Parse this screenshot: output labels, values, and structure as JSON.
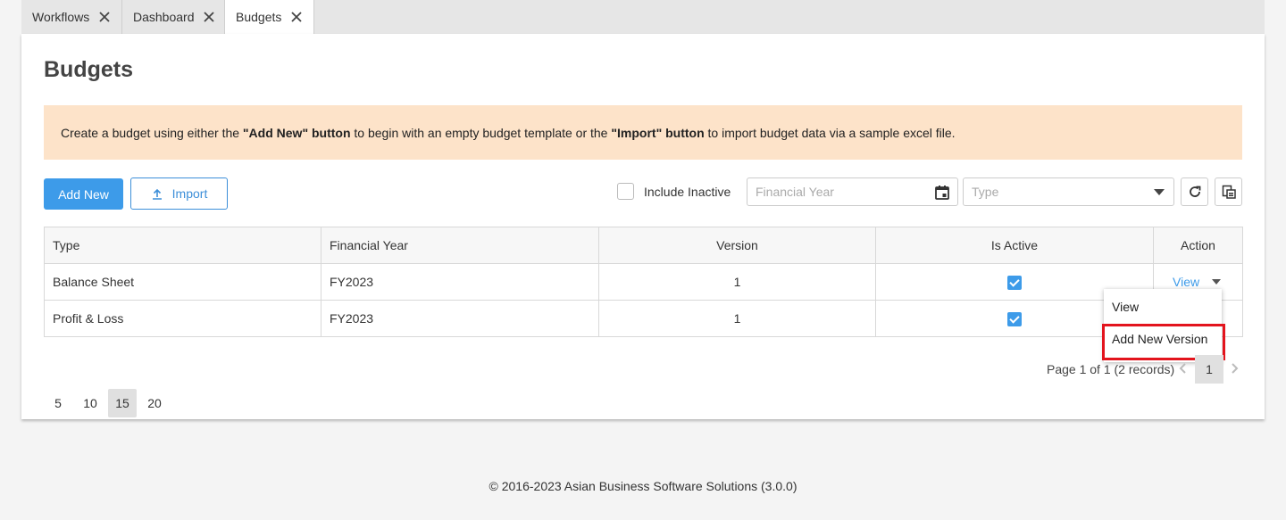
{
  "tabs": [
    {
      "label": "Workflows"
    },
    {
      "label": "Dashboard"
    },
    {
      "label": "Budgets"
    }
  ],
  "page": {
    "title": "Budgets"
  },
  "banner": {
    "text1": "Create a budget using either the ",
    "bold1": "\"Add New\" button",
    "text2": " to begin with an empty budget template or the ",
    "bold2": "\"Import\" button",
    "text3": " to import budget data via a sample excel file."
  },
  "toolbar": {
    "add_label": "Add New",
    "import_label": "Import",
    "include_inactive_label": "Include Inactive",
    "financial_year_placeholder": "Financial Year",
    "type_placeholder": "Type"
  },
  "table": {
    "headers": [
      "Type",
      "Financial Year",
      "Version",
      "Is Active",
      "Action"
    ],
    "rows": [
      {
        "type": "Balance Sheet",
        "fy": "FY2023",
        "version": "1",
        "active": true
      },
      {
        "type": "Profit & Loss",
        "fy": "FY2023",
        "version": "1",
        "active": true
      }
    ],
    "view_label": "View"
  },
  "dropdown": {
    "items": [
      "View",
      "Add New Version"
    ]
  },
  "pagination": {
    "sizes": [
      "5",
      "10",
      "15",
      "20"
    ],
    "selected_size": "15",
    "info": "Page 1 of 1 (2 records)",
    "current": "1"
  },
  "footer": "© 2016-2023 Asian Business Software Solutions (3.0.0)",
  "colors": {
    "primary": "#3d9be9",
    "banner": "#fde3c9",
    "highlight": "#e3141d"
  }
}
